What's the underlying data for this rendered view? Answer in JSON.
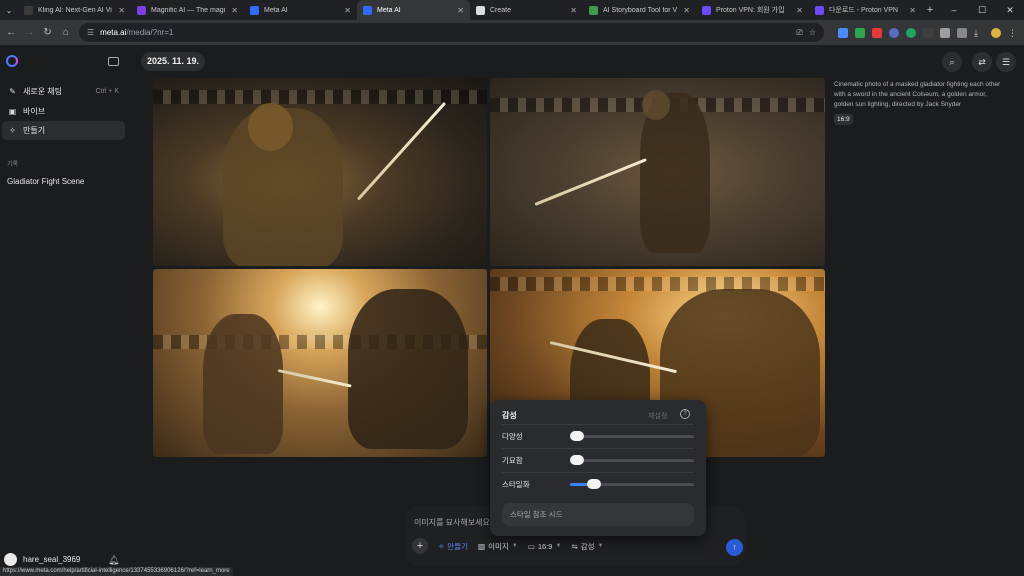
{
  "browser": {
    "tabs": [
      {
        "title": "Kling AI: Next-Gen AI Vi",
        "color": "#3a3a3a",
        "active": false
      },
      {
        "title": "Magnific AI — The magi",
        "color": "#7b3fe4",
        "active": false
      },
      {
        "title": "Meta AI",
        "color": "#2f6bff",
        "active": false
      },
      {
        "title": "Meta AI",
        "color": "#2f6bff",
        "active": true
      },
      {
        "title": "Create",
        "color": "#dddddd",
        "active": false
      },
      {
        "title": "AI Storyboard Tool for V",
        "color": "#3d9b4a",
        "active": false
      },
      {
        "title": "Proton VPN: 회원 가입",
        "color": "#6d4aff",
        "active": false
      },
      {
        "title": "다운로드 - Proton VPN",
        "color": "#6d4aff",
        "active": false
      }
    ],
    "new_tab_label": "+",
    "address": {
      "host": "meta.ai",
      "path": "/media/?nr=1"
    },
    "status_url": "https://www.meta.com/help/artificial-intelligence/1337455336906126/?ref=learn_more"
  },
  "sidebar": {
    "items": [
      {
        "icon": "edit-icon",
        "label": "새로운 채팅",
        "shortcut": "Ctrl + K"
      },
      {
        "icon": "vibe-icon",
        "label": "바이브",
        "shortcut": ""
      },
      {
        "icon": "wand-icon",
        "label": "만들기",
        "shortcut": ""
      }
    ],
    "history_label": "기록",
    "history_items": [
      "Gladiator Fight Scene"
    ],
    "user_name": "hare_seal_3969"
  },
  "main": {
    "date": "2025. 11. 19.",
    "prompt": "Cinematic photo of a masked gladiator fighting each other with a sword in the ancient Colseum, a golden armor, golden sun lighting, directed by Jack Snyder",
    "ratio": "16:9"
  },
  "composer": {
    "placeholder": "이미지를 묘사해보세요",
    "plus": "+",
    "make_label": "만들기",
    "image_label": "이미지",
    "ratio_label": "16:9",
    "style_label": "감성"
  },
  "style_popover": {
    "title": "감성",
    "reset": "재설정",
    "help": "?",
    "sliders": [
      {
        "label": "다양성",
        "value": 0.0
      },
      {
        "label": "기묘함",
        "value": 0.0
      },
      {
        "label": "스타일화",
        "value": 0.15
      }
    ],
    "seed_placeholder": "스타일 참조 시드"
  },
  "colors": {
    "accent": "#3b82f6",
    "make": "#5b8cff"
  }
}
